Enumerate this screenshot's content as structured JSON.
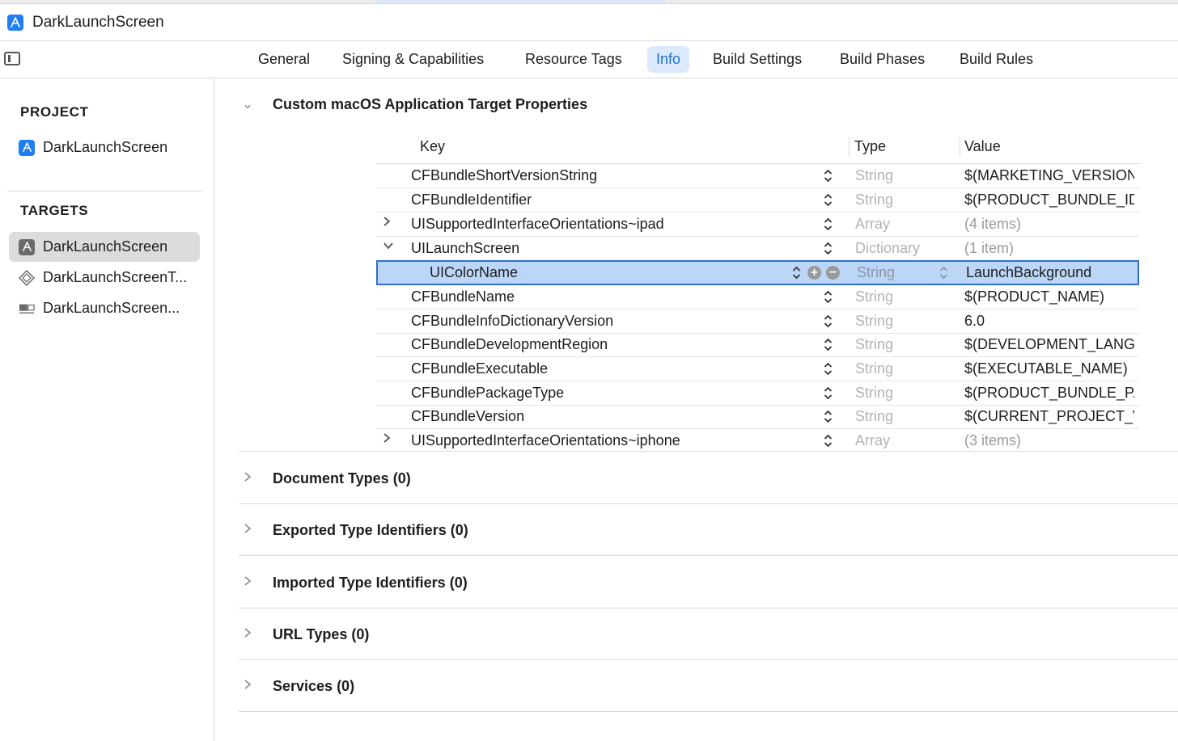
{
  "window": {
    "title": "DarkLaunchScreen"
  },
  "tabs": [
    {
      "label": "General"
    },
    {
      "label": "Signing & Capabilities"
    },
    {
      "label": "Resource Tags"
    },
    {
      "label": "Info",
      "active": true
    },
    {
      "label": "Build Settings"
    },
    {
      "label": "Build Phases"
    },
    {
      "label": "Build Rules"
    }
  ],
  "sidebar": {
    "project_header": "PROJECT",
    "project_item": "DarkLaunchScreen",
    "targets_header": "TARGETS",
    "targets": [
      {
        "label": "DarkLaunchScreen",
        "icon": "app-target-icon",
        "selected": true
      },
      {
        "label": "DarkLaunchScreenT...",
        "icon": "test-target-icon"
      },
      {
        "label": "DarkLaunchScreen...",
        "icon": "ui-test-target-icon"
      }
    ]
  },
  "properties": {
    "title": "Custom macOS Application Target Properties",
    "columns": {
      "key": "Key",
      "type": "Type",
      "value": "Value"
    },
    "rows": [
      {
        "key": "CFBundleShortVersionString",
        "type": "String",
        "value": "$(MARKETING_VERSION)"
      },
      {
        "key": "CFBundleIdentifier",
        "type": "String",
        "value": "$(PRODUCT_BUNDLE_IDENTIFIER)"
      },
      {
        "key": "UISupportedInterfaceOrientations~ipad",
        "type": "Array",
        "value": "(4 items)",
        "disclosure": "collapsed"
      },
      {
        "key": "UILaunchScreen",
        "type": "Dictionary",
        "value": "(1 item)",
        "disclosure": "expanded"
      },
      {
        "key": "UIColorName",
        "type": "String",
        "value": "LaunchBackground",
        "selected": true,
        "child": true
      },
      {
        "key": "CFBundleName",
        "type": "String",
        "value": "$(PRODUCT_NAME)"
      },
      {
        "key": "CFBundleInfoDictionaryVersion",
        "type": "String",
        "value": "6.0"
      },
      {
        "key": "CFBundleDevelopmentRegion",
        "type": "String",
        "value": "$(DEVELOPMENT_LANGUAGE)"
      },
      {
        "key": "CFBundleExecutable",
        "type": "String",
        "value": "$(EXECUTABLE_NAME)"
      },
      {
        "key": "CFBundlePackageType",
        "type": "String",
        "value": "$(PRODUCT_BUNDLE_PACKAGE_TYPE)"
      },
      {
        "key": "CFBundleVersion",
        "type": "String",
        "value": "$(CURRENT_PROJECT_VERSION)"
      },
      {
        "key": "UISupportedInterfaceOrientations~iphone",
        "type": "Array",
        "value": "(3 items)",
        "disclosure": "collapsed"
      }
    ]
  },
  "sections": [
    {
      "label": "Document Types (0)"
    },
    {
      "label": "Exported Type Identifiers (0)"
    },
    {
      "label": "Imported Type Identifiers (0)"
    },
    {
      "label": "URL Types (0)"
    },
    {
      "label": "Services (0)"
    }
  ],
  "colors": {
    "accent": "#1f7ef3",
    "selection": "#bcd6f7",
    "selection_border": "#2f6fd0"
  }
}
